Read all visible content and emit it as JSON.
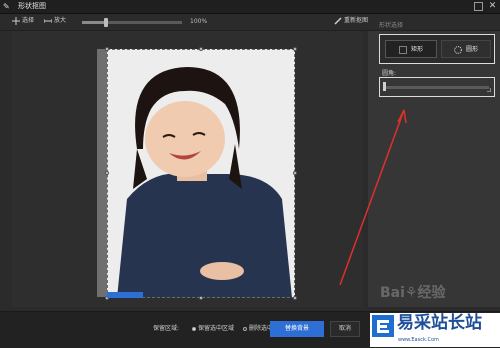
{
  "window": {
    "title": "形状抠图"
  },
  "toolbar": {
    "select_label": "选择",
    "enlarge_label": "放大",
    "zoom_value": "100%",
    "reset_label": "重新抠图",
    "zoom_fraction": 0.24
  },
  "panel": {
    "title": "形状选择",
    "shapes": [
      {
        "label": "矩形",
        "selected": true
      },
      {
        "label": "圆形",
        "selected": false
      }
    ],
    "radius_label": "圆角:",
    "radius_fraction": 0
  },
  "bottom": {
    "area_label": "保留区域:",
    "options": [
      {
        "label": "保留选中区域",
        "selected": true
      },
      {
        "label": "删除选中区域",
        "selected": false
      }
    ],
    "replace_label": "替换背景",
    "cancel_label": "取消"
  },
  "watermark": {
    "baidu_text": "Bai⚘经验",
    "logo_text": "易采站长站",
    "logo_url": "www.Easck.Com"
  },
  "colors": {
    "accent": "#2e6fd6",
    "annotation": "#e0302a",
    "background": "#2b2b2b"
  }
}
